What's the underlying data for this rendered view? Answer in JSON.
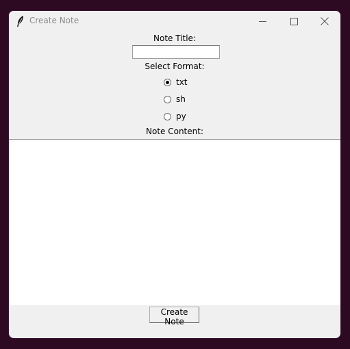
{
  "window": {
    "title": "Create Note",
    "controls": {
      "minimize_icon": "minimize-icon",
      "maximize_icon": "maximize-icon",
      "close_icon": "close-icon"
    }
  },
  "form": {
    "title_label": "Note Title:",
    "title_value": "",
    "format_label": "Select Format:",
    "formats": [
      {
        "label": "txt",
        "selected": true
      },
      {
        "label": "sh",
        "selected": false
      },
      {
        "label": "py",
        "selected": false
      }
    ],
    "content_label": "Note Content:",
    "content_value": "",
    "submit_label": "Create Note"
  },
  "colors": {
    "background": "#2d0a22",
    "window": "#f0f0f0",
    "title_text": "#8a8a8a"
  }
}
